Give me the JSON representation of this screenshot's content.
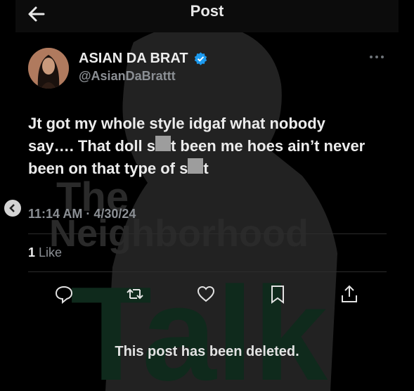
{
  "header": {
    "title": "Post"
  },
  "author": {
    "display_name": "ASIAN DA BRAT",
    "handle": "@AsianDaBrattt",
    "verified": true
  },
  "tweet": {
    "text_line1": "Jt got my whole style idgaf what nobody",
    "text_line2a": "say…. That doll s",
    "text_line2b": "t been me hoes ain’t never",
    "text_line3a": "been on that type of s",
    "text_line3b": "t"
  },
  "meta": {
    "timestamp": "11:14 AM · 4/30/24"
  },
  "engagement": {
    "like_count": "1",
    "like_label": "Like"
  },
  "actions": [
    "reply-icon",
    "repost-icon",
    "like-icon",
    "bookmark-icon",
    "share-icon"
  ],
  "watermark": {
    "line1": "The",
    "line2": "Neighborhood",
    "line3": "Talk"
  },
  "status": {
    "message": "This post has been deleted."
  },
  "colors": {
    "background": "#000000",
    "verified": "#1d9bf0",
    "muted": "#8b8f94",
    "watermark_green": "#0f2a1c"
  }
}
